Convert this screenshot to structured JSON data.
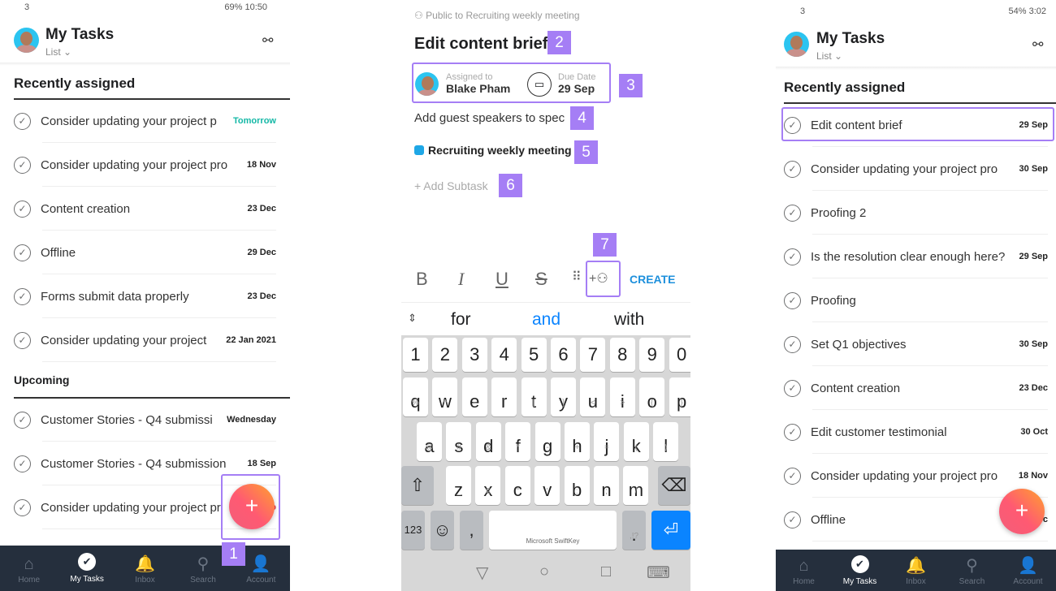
{
  "left": {
    "status": {
      "carrier": "3",
      "right": "69%  10:50"
    },
    "header": {
      "title": "My Tasks",
      "view": "List",
      "view_chevron": "chevron-down-icon",
      "filter_icon": "filter-icon"
    },
    "recent_label": "Recently assigned",
    "recent": [
      {
        "name": "Consider updating your project p",
        "date": "Tomorrow",
        "color": "teal"
      },
      {
        "name": "Consider updating your project pro",
        "date": "18 Nov"
      },
      {
        "name": "Content creation",
        "date": "23 Dec"
      },
      {
        "name": "Offline",
        "date": "29 Dec"
      },
      {
        "name": "Forms submit data properly",
        "date": "23 Dec"
      },
      {
        "name": "Consider updating your project",
        "date": "22 Jan 2021"
      }
    ],
    "upcoming_label": "Upcoming",
    "upcoming": [
      {
        "name": "Customer Stories - Q4 submissi",
        "date": "Wednesday"
      },
      {
        "name": "Customer Stories - Q4 submission",
        "date": "18 Sep"
      },
      {
        "name": "Consider updating your project pr",
        "date": "o",
        "color": "red"
      }
    ],
    "fab": "+",
    "badge": "1"
  },
  "nav": [
    {
      "label": "Home",
      "icon": "home-icon",
      "glyph": "⌂"
    },
    {
      "label": "My Tasks",
      "icon": "check-circle-icon",
      "glyph": "✔",
      "active": true
    },
    {
      "label": "Inbox",
      "icon": "bell-icon",
      "glyph": "🔔"
    },
    {
      "label": "Search",
      "icon": "search-icon",
      "glyph": "⚲"
    },
    {
      "label": "Account",
      "icon": "account-icon",
      "glyph": "👤"
    }
  ],
  "middle": {
    "privacy": "Public to Recruiting weekly meeting",
    "title": "Edit content brief",
    "assigned_label": "Assigned to",
    "assignee": "Blake Pham",
    "due_label": "Due Date",
    "due": "29 Sep",
    "description": "Add guest speakers to spec",
    "project": "Recruiting weekly meeting",
    "project_color": "#1ea7e6",
    "add_subtask": "+ Add Subtask",
    "toolbar": {
      "bold": "B",
      "italic": "I",
      "underline": "U",
      "strike": "S",
      "create": "CREATE"
    },
    "suggestions": [
      "for",
      "and",
      "with"
    ],
    "badges": [
      "2",
      "3",
      "4",
      "5",
      "6",
      "7"
    ],
    "keyboard": {
      "numbers": [
        "1",
        "2",
        "3",
        "4",
        "5",
        "6",
        "7",
        "8",
        "9",
        "0"
      ],
      "row1": [
        [
          "q",
          "%"
        ],
        [
          "w",
          "^"
        ],
        [
          "e",
          "~"
        ],
        [
          "r",
          "|"
        ],
        [
          "t",
          "["
        ],
        [
          "y",
          "]"
        ],
        [
          "u",
          "<"
        ],
        [
          "i",
          ">"
        ],
        [
          "o",
          "{"
        ],
        [
          "p",
          "}"
        ]
      ],
      "row2": [
        [
          "a",
          "@"
        ],
        [
          "s",
          "#"
        ],
        [
          "d",
          "&"
        ],
        [
          "f",
          "*"
        ],
        [
          "g",
          "-"
        ],
        [
          "h",
          "+"
        ],
        [
          "j",
          "="
        ],
        [
          "k",
          "("
        ],
        [
          "l",
          ")"
        ]
      ],
      "row3": [
        [
          "z",
          "_"
        ],
        [
          "x",
          "€"
        ],
        [
          "c",
          "\""
        ],
        [
          "v",
          "'"
        ],
        [
          "b",
          ":"
        ],
        [
          "n",
          ";"
        ],
        [
          "m",
          "/"
        ]
      ],
      "num_key": "123",
      "space_label": "Microsoft SwiftKey",
      "comma": ",",
      "period": ".",
      "period_alt": ",!?"
    },
    "accent": "#0a84ff"
  },
  "right": {
    "status": {
      "carrier": "3",
      "right": "54%  3:02"
    },
    "header": {
      "title": "My Tasks",
      "view": "List"
    },
    "recent_label": "Recently assigned",
    "recent": [
      {
        "name": "Edit content brief",
        "date": "29 Sep"
      },
      {
        "name": "Consider updating your project pro",
        "date": "30 Sep"
      },
      {
        "name": "Proofing 2",
        "date": ""
      },
      {
        "name": "Is the resolution clear enough here?",
        "date": "29 Sep"
      },
      {
        "name": "Proofing",
        "date": ""
      },
      {
        "name": "Set Q1 objectives",
        "date": "30 Sep"
      },
      {
        "name": "Content creation",
        "date": "23 Dec"
      },
      {
        "name": "Edit customer testimonial",
        "date": "30 Oct"
      },
      {
        "name": "Consider updating your project pro",
        "date": "18 Nov"
      },
      {
        "name": "Offline",
        "date": "c"
      }
    ],
    "fab": "+"
  }
}
